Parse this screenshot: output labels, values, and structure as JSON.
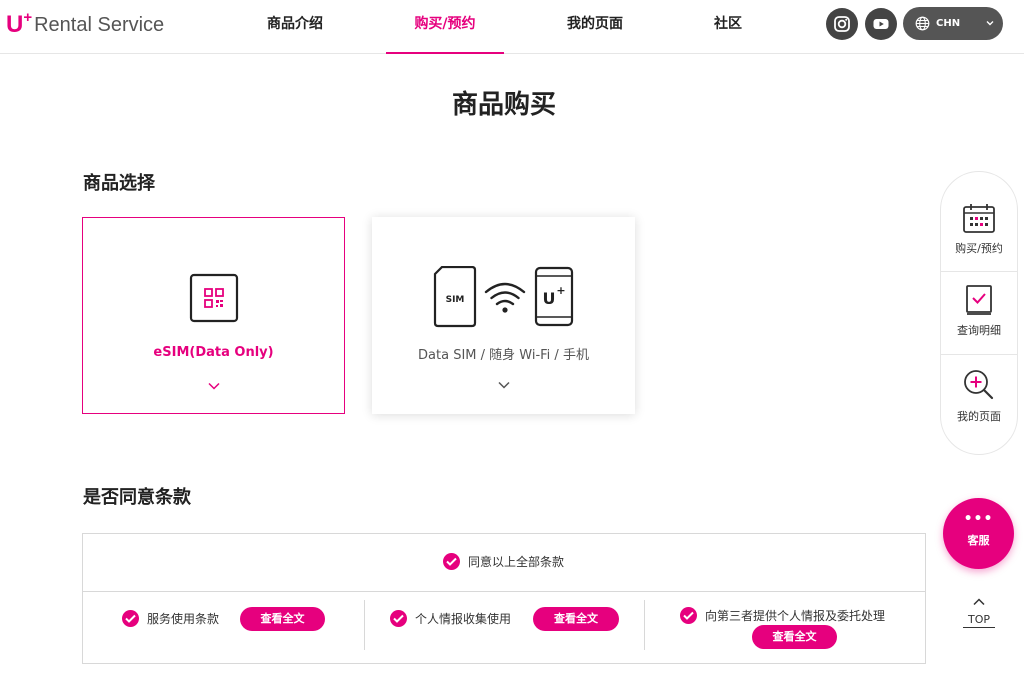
{
  "brand": {
    "logo_u": "U",
    "logo_plus": "+",
    "logo_text": "Rental Service",
    "accent": "#e6007e"
  },
  "nav": [
    {
      "label": "商品介绍"
    },
    {
      "label": "购买/预约"
    },
    {
      "label": "我的页面"
    },
    {
      "label": "社区"
    }
  ],
  "header_icons": [
    "instagram-icon",
    "youtube-icon"
  ],
  "language": {
    "selected": "CHN"
  },
  "page_title": "商品购买",
  "product_section": {
    "title": "商品选择",
    "cards": [
      {
        "label": "eSIM(Data Only)",
        "icon": "esim-qr-icon",
        "selected": true
      },
      {
        "label": "Data SIM / 随身 Wi-Fi / 手机",
        "icon": "sim-wifi-phone-icon",
        "selected": false,
        "sim_text": "SIM",
        "phone_logo_u": "U",
        "phone_logo_plus": "+"
      }
    ]
  },
  "terms_section": {
    "title": "是否同意条款",
    "agree_all": "同意以上全部条款",
    "items": [
      {
        "label": "服务使用条款",
        "button": "查看全文"
      },
      {
        "label": "个人情报收集使用",
        "button": "查看全文"
      },
      {
        "label": "向第三者提供个人情报及委托处理",
        "button": "查看全文"
      }
    ]
  },
  "side_menu": [
    {
      "label": "购买/预约",
      "icon": "calendar-icon"
    },
    {
      "label": "查询明细",
      "icon": "checklist-icon"
    },
    {
      "label": "我的页面",
      "icon": "zoom-in-icon"
    }
  ],
  "support": {
    "dots": "•••",
    "label": "客服"
  },
  "top_button": {
    "label": "TOP"
  }
}
